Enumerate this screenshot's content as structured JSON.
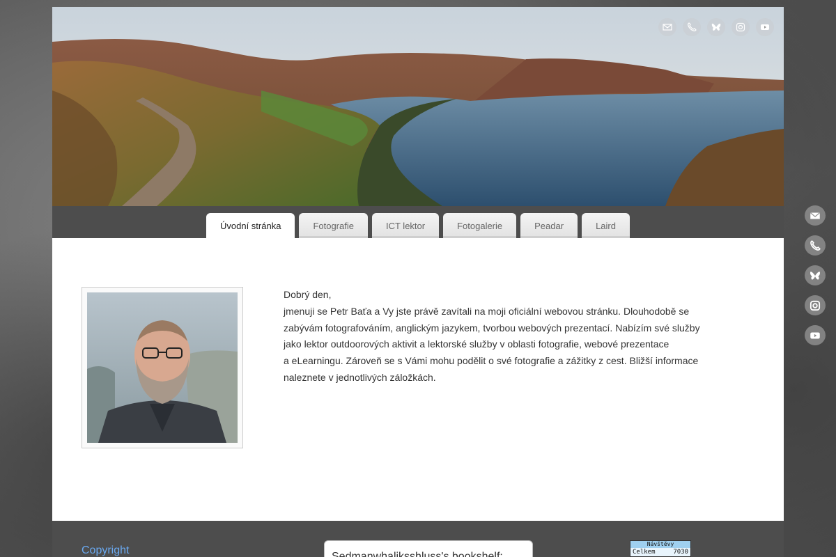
{
  "social": {
    "items": [
      {
        "name": "email-icon"
      },
      {
        "name": "phone-icon"
      },
      {
        "name": "bluesky-icon"
      },
      {
        "name": "instagram-icon"
      },
      {
        "name": "youtube-icon"
      }
    ]
  },
  "nav": {
    "tabs": [
      {
        "label": "Úvodní stránka",
        "active": true
      },
      {
        "label": "Fotografie",
        "active": false
      },
      {
        "label": "ICT lektor",
        "active": false
      },
      {
        "label": "Fotogalerie",
        "active": false
      },
      {
        "label": "Peadar",
        "active": false
      },
      {
        "label": "Laird",
        "active": false
      }
    ]
  },
  "intro": {
    "greeting": "Dobrý den,",
    "lines": [
      "jmenuji se Petr Baťa a Vy jste právě zavítali na moji oficiální webovou stránku. Dlouhodobě se",
      "zabývám fotografováním, anglickým jazykem, tvorbou webových prezentací. Nabízím své služby",
      "jako lektor outdoorových aktivit a lektorské služby v oblasti fotografie, webové prezentace",
      "a eLearningu. Zároveň se s Vámi mohu podělit o své fotografie a zážitky z cest. Bližší informace",
      "naleznete v jednotlivých záložkách."
    ]
  },
  "footer": {
    "copyright": "Copyright",
    "bookshelf": "Sedmanwhaliksshluss's bookshelf:",
    "counter": {
      "title": "Návštěvy",
      "label": "Celkem",
      "value": "7030"
    }
  },
  "colors": {
    "nav_bg": "#4d4d4d",
    "link": "#6aa9f0"
  }
}
